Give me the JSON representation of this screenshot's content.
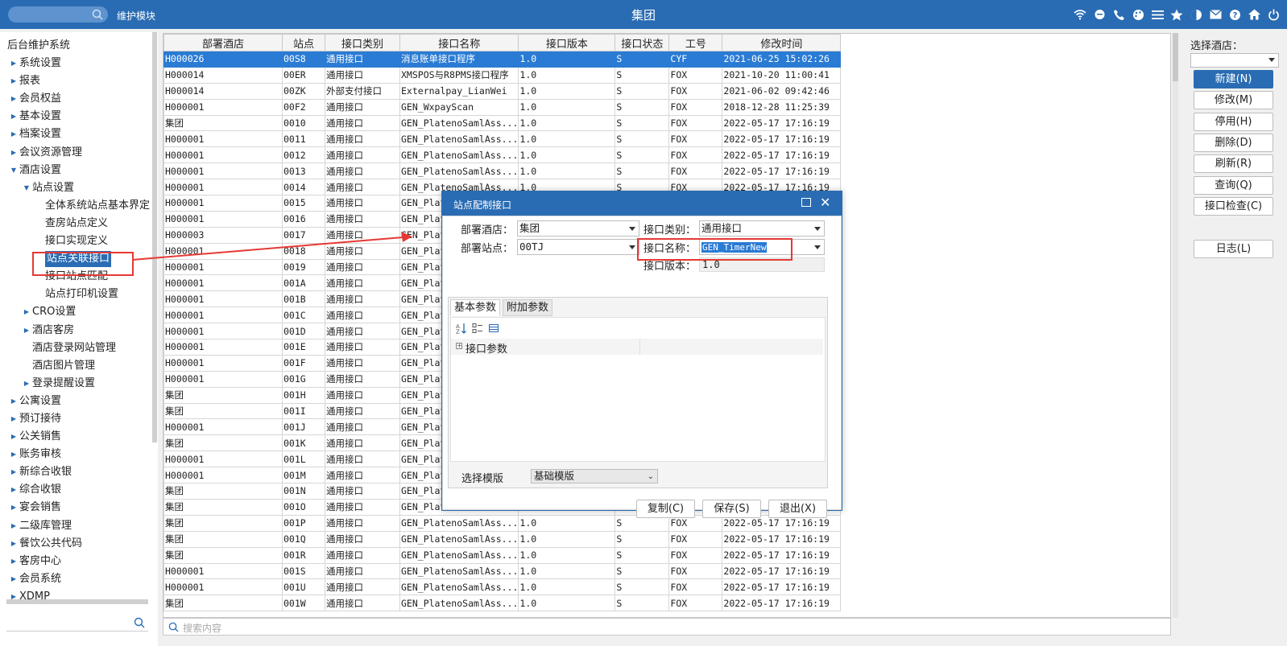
{
  "topbar": {
    "title": "集团",
    "module_label": "维护模块",
    "icons": [
      "wifi-icon",
      "chat-icon",
      "phone-icon",
      "palette-icon",
      "menu-icon",
      "star-icon",
      "theme-icon",
      "mail-icon",
      "help-icon",
      "home-icon",
      "power-icon"
    ]
  },
  "sidebar": {
    "root": "后台维护系统",
    "items": [
      {
        "label": "系统设置",
        "level": 1,
        "caret": "collapsed"
      },
      {
        "label": "报表",
        "level": 1,
        "caret": "collapsed"
      },
      {
        "label": "会员权益",
        "level": 1,
        "caret": "collapsed"
      },
      {
        "label": "基本设置",
        "level": 1,
        "caret": "collapsed"
      },
      {
        "label": "档案设置",
        "level": 1,
        "caret": "collapsed"
      },
      {
        "label": "会议资源管理",
        "level": 1,
        "caret": "collapsed"
      },
      {
        "label": "酒店设置",
        "level": 1,
        "caret": "expanded"
      },
      {
        "label": "站点设置",
        "level": 2,
        "caret": "expanded"
      },
      {
        "label": "全体系统站点基本界定",
        "level": 3,
        "caret": "none"
      },
      {
        "label": "查房站点定义",
        "level": 3,
        "caret": "none"
      },
      {
        "label": "接口实现定义",
        "level": 3,
        "caret": "none"
      },
      {
        "label": "站点关联接口",
        "level": 3,
        "caret": "none",
        "selected": true
      },
      {
        "label": "接口站点匹配",
        "level": 3,
        "caret": "none"
      },
      {
        "label": "站点打印机设置",
        "level": 3,
        "caret": "none"
      },
      {
        "label": "CRO设置",
        "level": 2,
        "caret": "collapsed"
      },
      {
        "label": "酒店客房",
        "level": 2,
        "caret": "collapsed"
      },
      {
        "label": "酒店登录网站管理",
        "level": 2,
        "caret": "none"
      },
      {
        "label": "酒店图片管理",
        "level": 2,
        "caret": "none"
      },
      {
        "label": "登录提醒设置",
        "level": 2,
        "caret": "collapsed"
      },
      {
        "label": "公寓设置",
        "level": 1,
        "caret": "collapsed"
      },
      {
        "label": "预订接待",
        "level": 1,
        "caret": "collapsed"
      },
      {
        "label": "公关销售",
        "level": 1,
        "caret": "collapsed"
      },
      {
        "label": "账务审核",
        "level": 1,
        "caret": "collapsed"
      },
      {
        "label": "新综合收银",
        "level": 1,
        "caret": "collapsed"
      },
      {
        "label": "综合收银",
        "level": 1,
        "caret": "collapsed"
      },
      {
        "label": "宴会销售",
        "level": 1,
        "caret": "collapsed"
      },
      {
        "label": "二级库管理",
        "level": 1,
        "caret": "collapsed"
      },
      {
        "label": "餐饮公共代码",
        "level": 1,
        "caret": "collapsed"
      },
      {
        "label": "客房中心",
        "level": 1,
        "caret": "collapsed"
      },
      {
        "label": "会员系统",
        "level": 1,
        "caret": "collapsed"
      },
      {
        "label": "XDMP",
        "level": 1,
        "caret": "collapsed"
      }
    ]
  },
  "grid": {
    "columns": [
      "部署酒店",
      "站点",
      "接口类别",
      "接口名称",
      "接口版本",
      "接口状态",
      "工号",
      "修改时间"
    ],
    "rows": [
      [
        "H000026",
        "00S8",
        "通用接口",
        "消息账单接口程序",
        "1.0",
        "S",
        "CYF",
        "2021-06-25 15:02:26"
      ],
      [
        "H000014",
        "00ER",
        "通用接口",
        "XMSPOS与R8PMS接口程序",
        "1.0",
        "S",
        "FOX",
        "2021-10-20 11:00:41"
      ],
      [
        "H000014",
        "00ZK",
        "外部支付接口",
        "Externalpay_LianWei",
        "1.0",
        "S",
        "FOX",
        "2021-06-02 09:42:46"
      ],
      [
        "H000001",
        "00F2",
        "通用接口",
        "GEN_WxpayScan",
        "1.0",
        "S",
        "FOX",
        "2018-12-28 11:25:39"
      ],
      [
        "集团",
        "0010",
        "通用接口",
        "GEN_PlatenoSamlAss...",
        "1.0",
        "S",
        "FOX",
        "2022-05-17 17:16:19"
      ],
      [
        "H000001",
        "0011",
        "通用接口",
        "GEN_PlatenoSamlAss...",
        "1.0",
        "S",
        "FOX",
        "2022-05-17 17:16:19"
      ],
      [
        "H000001",
        "0012",
        "通用接口",
        "GEN_PlatenoSamlAss...",
        "1.0",
        "S",
        "FOX",
        "2022-05-17 17:16:19"
      ],
      [
        "H000001",
        "0013",
        "通用接口",
        "GEN_PlatenoSamlAss...",
        "1.0",
        "S",
        "FOX",
        "2022-05-17 17:16:19"
      ],
      [
        "H000001",
        "0014",
        "通用接口",
        "GEN_PlatenoSamlAss...",
        "1.0",
        "S",
        "FOX",
        "2022-05-17 17:16:19"
      ],
      [
        "H000001",
        "0015",
        "通用接口",
        "GEN_Plat",
        "",
        "",
        "",
        ""
      ],
      [
        "H000001",
        "0016",
        "通用接口",
        "GEN_Plat",
        "",
        "",
        "",
        ""
      ],
      [
        "H000003",
        "0017",
        "通用接口",
        "GEN_Plat",
        "",
        "",
        "",
        ""
      ],
      [
        "H000001",
        "0018",
        "通用接口",
        "GEN_Plat",
        "",
        "",
        "",
        ""
      ],
      [
        "H000001",
        "0019",
        "通用接口",
        "GEN_Plat",
        "",
        "",
        "",
        ""
      ],
      [
        "H000001",
        "001A",
        "通用接口",
        "GEN_Plat",
        "",
        "",
        "",
        ""
      ],
      [
        "H000001",
        "001B",
        "通用接口",
        "GEN_Plat",
        "",
        "",
        "",
        ""
      ],
      [
        "H000001",
        "001C",
        "通用接口",
        "GEN_Plat",
        "",
        "",
        "",
        ""
      ],
      [
        "H000001",
        "001D",
        "通用接口",
        "GEN_Plat",
        "",
        "",
        "",
        ""
      ],
      [
        "H000001",
        "001E",
        "通用接口",
        "GEN_Plat",
        "",
        "",
        "",
        ""
      ],
      [
        "H000001",
        "001F",
        "通用接口",
        "GEN_Plat",
        "",
        "",
        "",
        ""
      ],
      [
        "H000001",
        "001G",
        "通用接口",
        "GEN_Plat",
        "",
        "",
        "",
        ""
      ],
      [
        "集团",
        "001H",
        "通用接口",
        "GEN_Plat",
        "",
        "",
        "",
        ""
      ],
      [
        "集团",
        "001I",
        "通用接口",
        "GEN_Plat",
        "",
        "",
        "",
        ""
      ],
      [
        "H000001",
        "001J",
        "通用接口",
        "GEN_Plat",
        "",
        "",
        "",
        ""
      ],
      [
        "集团",
        "001K",
        "通用接口",
        "GEN_Plat",
        "",
        "",
        "",
        ""
      ],
      [
        "H000001",
        "001L",
        "通用接口",
        "GEN_Plat",
        "",
        "",
        "",
        ""
      ],
      [
        "H000001",
        "001M",
        "通用接口",
        "GEN_Plat",
        "",
        "",
        "",
        ""
      ],
      [
        "集团",
        "001N",
        "通用接口",
        "GEN_Plat",
        "",
        "",
        "",
        ""
      ],
      [
        "集团",
        "001O",
        "通用接口",
        "GEN_Plat",
        "",
        "",
        "",
        ""
      ],
      [
        "集团",
        "001P",
        "通用接口",
        "GEN_PlatenoSamlAss...",
        "1.0",
        "S",
        "FOX",
        "2022-05-17 17:16:19"
      ],
      [
        "集团",
        "001Q",
        "通用接口",
        "GEN_PlatenoSamlAss...",
        "1.0",
        "S",
        "FOX",
        "2022-05-17 17:16:19"
      ],
      [
        "集团",
        "001R",
        "通用接口",
        "GEN_PlatenoSamlAss...",
        "1.0",
        "S",
        "FOX",
        "2022-05-17 17:16:19"
      ],
      [
        "H000001",
        "001S",
        "通用接口",
        "GEN_PlatenoSamlAss...",
        "1.0",
        "S",
        "FOX",
        "2022-05-17 17:16:19"
      ],
      [
        "H000001",
        "001U",
        "通用接口",
        "GEN_PlatenoSamlAss...",
        "1.0",
        "S",
        "FOX",
        "2022-05-17 17:16:19"
      ],
      [
        "集团",
        "001W",
        "通用接口",
        "GEN_PlatenoSamlAss...",
        "1.0",
        "S",
        "FOX",
        "2022-05-17 17:16:19"
      ]
    ],
    "selected_row": 0,
    "search_placeholder": "搜索内容"
  },
  "right_panel": {
    "hotel_label": "选择酒店：",
    "hotel_value": "",
    "buttons": [
      "新建(N)",
      "修改(M)",
      "停用(H)",
      "删除(D)",
      "刷新(R)",
      "查询(Q)",
      "接口检查(C)"
    ],
    "log_button": "日志(L)"
  },
  "dialog": {
    "title": "站点配制接口",
    "hotel_label": "部署酒店：",
    "hotel_value": "集团",
    "station_label": "部署站点：",
    "station_value": "00TJ",
    "category_label": "接口类别：",
    "category_value": "通用接口",
    "name_label": "接口名称：",
    "name_value": "GEN_TimerNew",
    "version_label": "接口版本：",
    "version_value": "1.0",
    "tabs": [
      "基本参数",
      "附加参数"
    ],
    "property_group": "接口参数",
    "template_label": "选择模版",
    "template_value": "基础模版",
    "buttons": {
      "copy": "复制(C)",
      "save": "保存(S)",
      "exit": "退出(X)"
    }
  },
  "colors": {
    "primary": "#2a6cb3",
    "selection": "#2a7bd4",
    "annotation": "#e53935"
  }
}
